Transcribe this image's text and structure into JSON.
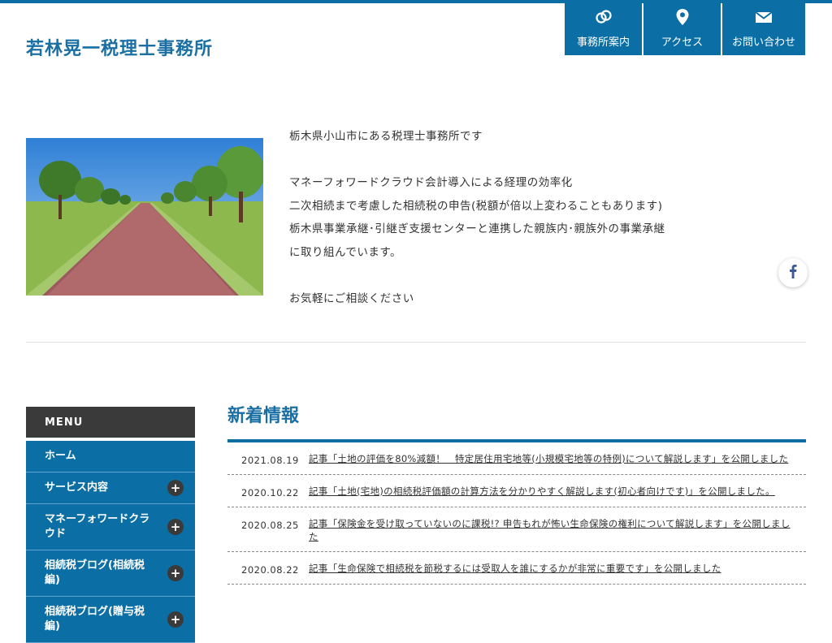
{
  "site": {
    "title": "若林晃一税理士事務所"
  },
  "gnav": [
    {
      "icon": "office-icon",
      "label": "事務所案内"
    },
    {
      "icon": "location-pin-icon",
      "label": "アクセス"
    },
    {
      "icon": "mail-icon",
      "label": "お問い合わせ"
    }
  ],
  "intro": {
    "lines": [
      "栃木県小山市にある税理士事務所です",
      "",
      "マネーフォワードクラウド会計導入による経理の効率化",
      "二次相続まで考慮した相続税の申告(税額が倍以上変わることもあります)",
      "栃木県事業承継･引継ぎ支援センターと連携した親族内･親族外の事業承継",
      "に取り組んでいます。",
      "",
      "お気軽にご相談ください"
    ]
  },
  "social": {
    "facebook_icon": "facebook-icon"
  },
  "sidebar": {
    "heading": "MENU",
    "items": [
      {
        "label": "ホーム",
        "expandable": false
      },
      {
        "label": "サービス内容",
        "expandable": true
      },
      {
        "label": "マネーフォワードクラウド",
        "expandable": true
      },
      {
        "label": "相続税ブログ(相続税編)",
        "expandable": true
      },
      {
        "label": "相続税ブログ(贈与税編)",
        "expandable": true
      }
    ],
    "expand_symbol": "+"
  },
  "news": {
    "title": "新着情報",
    "items": [
      {
        "date": "2021.08.19",
        "text": "記事「土地の評価を80%減額！　特定居住用宅地等(小規模宅地等の特例)について解説します」を公開しました"
      },
      {
        "date": "2020.10.22",
        "text": "記事「土地(宅地)の相続税評価額の計算方法を分かりやすく解説します(初心者向けです)」を公開しました。"
      },
      {
        "date": "2020.08.25",
        "text": "記事「保険金を受け取っていないのに課税!? 申告もれが怖い生命保険の権利について解説します」を公開しました"
      },
      {
        "date": "2020.08.22",
        "text": "記事「生命保険で相続税を節税するには受取人を誰にするかが非常に重要です」を公開しました"
      }
    ]
  },
  "colors": {
    "brand": "#0b6fa6",
    "title": "#1a6fa3",
    "menu_head": "#3a3a3a"
  }
}
